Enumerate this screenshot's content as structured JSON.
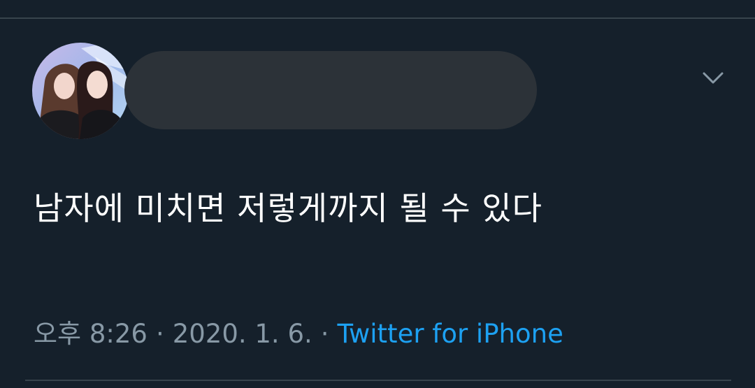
{
  "tweet": {
    "text": "남자에 미치면 저렇게까지 될 수 있다",
    "time": "오후 8:26",
    "separator": "·",
    "date": "2020. 1. 6.",
    "source": "Twitter for iPhone"
  },
  "icons": {
    "caret": "chevron-down-icon"
  },
  "colors": {
    "background": "#15202b",
    "text": "#ffffff",
    "meta": "#8899a6",
    "link": "#1da1f2",
    "divider": "#38444d"
  }
}
